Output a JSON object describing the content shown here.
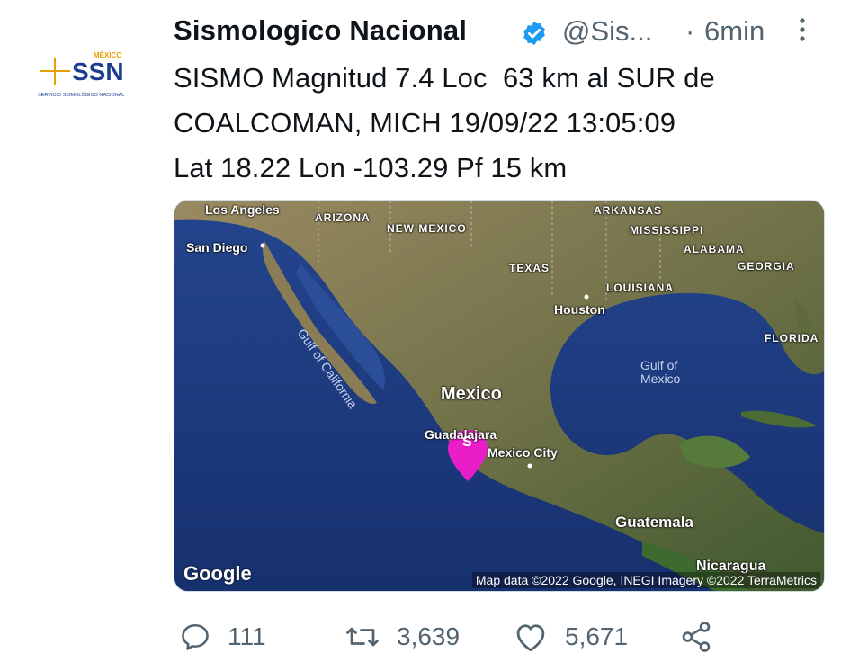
{
  "avatar": {
    "logo_text": "SSN",
    "logo_country": "MÉXICO",
    "logo_sub": "SERVICIO SISMOLÓGICO NACIONAL"
  },
  "tweet": {
    "author_name": "Sismologico Nacional",
    "handle": "@Sis...",
    "separator": "·",
    "time": "6min",
    "text": "SISMO Magnitud 7.4 Loc  63 km al SUR de\nCOALCOMAN, MICH 19/09/22 13:05:09\nLat 18.22 Lon -103.29 Pf 15 km"
  },
  "map": {
    "labels": {
      "los_angeles": "Los Angeles",
      "san_diego": "San Diego",
      "arizona": "ARIZONA",
      "new_mexico": "NEW MEXICO",
      "texas": "TEXAS",
      "arkansas": "ARKANSAS",
      "mississippi": "MISSISSIPPI",
      "alabama": "ALABAMA",
      "georgia": "GEORGIA",
      "louisiana": "LOUISIANA",
      "houston": "Houston",
      "florida": "FLORIDA",
      "gulf_california": "Gulf of California",
      "gulf_mexico_1": "Gulf of",
      "gulf_mexico_2": "Mexico",
      "mexico": "Mexico",
      "guadalajara": "Guadalajara",
      "mexico_city": "Mexico City",
      "guatemala": "Guatemala",
      "nicaragua": "Nicaragua"
    },
    "marker_letter": "S",
    "marker_color": "#e91ec8",
    "google": "Google",
    "attribution": "Map data ©2022 Google, INEGI Imagery ©2022 TerraMetrics"
  },
  "actions": {
    "replies": "111",
    "retweets": "3,639",
    "likes": "5,671"
  },
  "colors": {
    "verified": "#1d9bf0",
    "secondary_text": "#536471",
    "ocean": "#1d3d87",
    "land": "#7d6f4c"
  }
}
